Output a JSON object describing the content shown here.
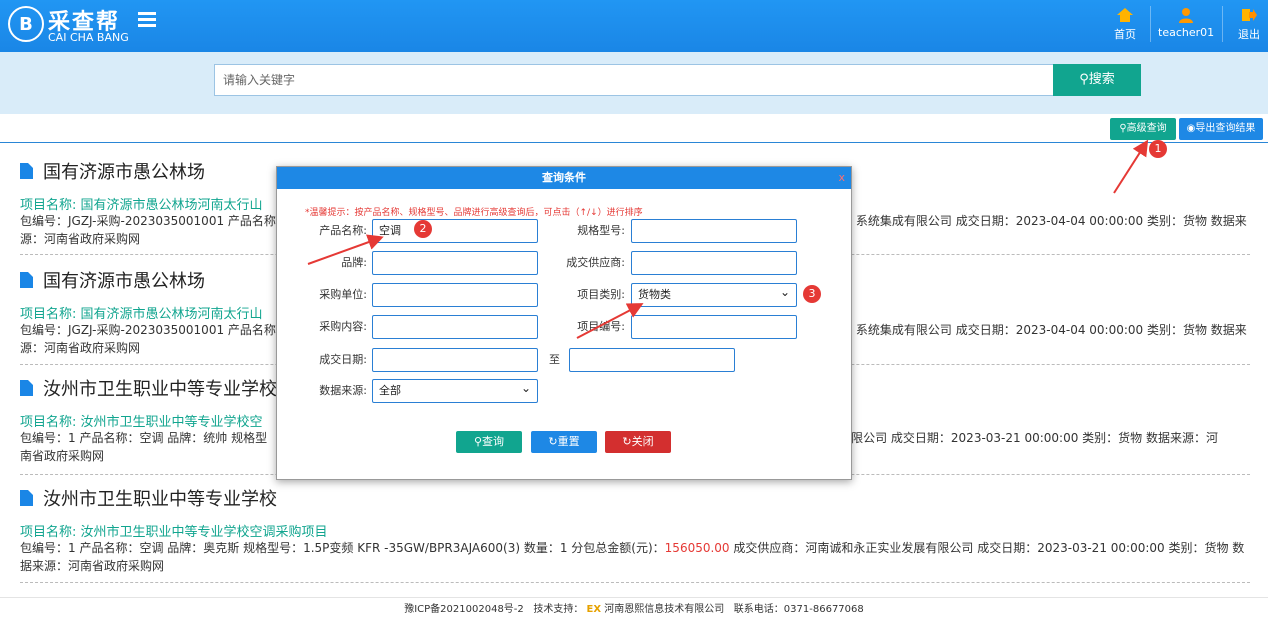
{
  "header": {
    "logo_letter": "B",
    "brand_cn": "采查帮",
    "brand_en": "CAI CHA BANG",
    "nav": {
      "home": "首页",
      "user": "teacher01",
      "logout": "退出"
    }
  },
  "search": {
    "placeholder": "请输入关键字",
    "button": "搜索"
  },
  "actions": {
    "advanced": "高级查询",
    "export": "导出查询结果"
  },
  "results": [
    {
      "title": "国有济源市愚公林场",
      "project_label": "项目名称:",
      "project_name": "国有济源市愚公林场河南太行山",
      "meta_left": "包编号：JGZJ-采购-2023035001001  产品名称：",
      "meta_right": "系统集成有限公司  成交日期：2023-04-04 00:00:00  类别：货物  数据来",
      "meta_line2": "源：河南省政府采购网"
    },
    {
      "title": "国有济源市愚公林场",
      "project_label": "项目名称:",
      "project_name": "国有济源市愚公林场河南太行山",
      "meta_left": "包编号：JGZJ-采购-2023035001001  产品名称：",
      "meta_right": "系统集成有限公司  成交日期：2023-04-04 00:00:00  类别：货物  数据来",
      "meta_line2": "源：河南省政府采购网"
    },
    {
      "title": "汝州市卫生职业中等专业学校",
      "project_label": "项目名称:",
      "project_name": "汝州市卫生职业中等专业学校空",
      "meta_left": "包编号：1  产品名称：空调  品牌：统帅  规格型",
      "meta_right": "展有限公司  成交日期：2023-03-21 00:00:00  类别：货物  数据来源：河",
      "meta_line2": "南省政府采购网"
    },
    {
      "title": "汝州市卫生职业中等专业学校",
      "project_label": "项目名称:",
      "project_name": "汝州市卫生职业中等专业学校空调采购项目",
      "meta_full": "包编号：1  产品名称：空调  品牌：奥克斯  规格型号：1.5P变频 KFR -35GW/BPR3AJA600(3)  数量：1  分包总金额(元)：",
      "amount": "156050.00",
      "meta_after": "  成交供应商：河南诚和永正实业发展有限公司  成交日期：2023-03-21 00:00:00  类别：货物  数",
      "meta_line2": "据来源：河南省政府采购网"
    }
  ],
  "modal": {
    "title": "查询条件",
    "close": "x",
    "tip": "*温馨提示：按产品名称、规格型号、品牌进行高级查询后，可点击（↑/↓）进行排序",
    "fields": {
      "product_label": "产品名称:",
      "product_value": "空调",
      "spec_label": "规格型号:",
      "brand_label": "品牌:",
      "supplier_label": "成交供应商:",
      "buyer_label": "采购单位:",
      "category_label": "项目类别:",
      "category_value": "货物类",
      "content_label": "采购内容:",
      "project_no_label": "项目编号:",
      "date_label": "成交日期:",
      "date_to": "至",
      "source_label": "数据来源:",
      "source_value": "全部"
    },
    "buttons": {
      "query": "查询",
      "reset": "重置",
      "close": "关闭"
    }
  },
  "annotations": [
    "1",
    "2",
    "3"
  ],
  "footer": {
    "icp": "豫ICP备2021002048号-2",
    "support_label": "技术支持：",
    "support_logo": "EX",
    "company": "河南恩熙信息技术有限公司",
    "phone": "联系电话：0371-86677068"
  },
  "colors": {
    "primary": "#1e88e5",
    "teal": "#11a58f",
    "danger": "#e53935",
    "band": "#d9ecf9"
  }
}
